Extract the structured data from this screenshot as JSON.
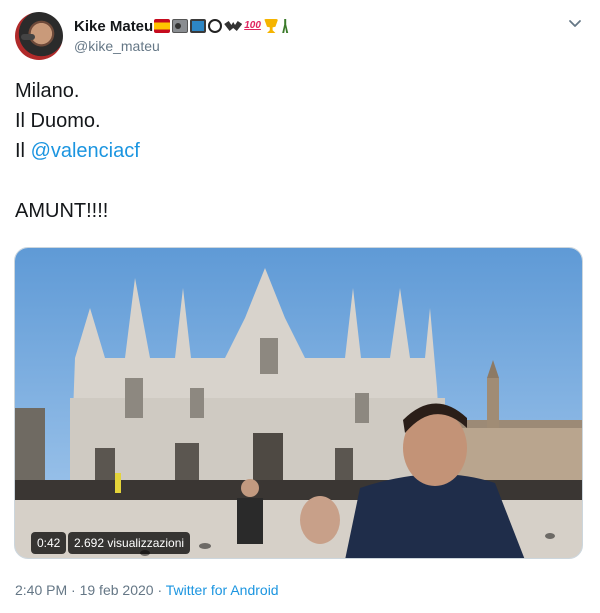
{
  "author": {
    "display_name": "Kike Mateu",
    "handle": "@kike_mateu",
    "emojis": [
      "spain-flag-icon",
      "radio-icon",
      "tv-icon",
      "soccer-ball-icon",
      "bat-icon",
      "hundred-points-icon",
      "trophy-icon",
      "golfer-icon"
    ]
  },
  "tweet": {
    "lines": [
      "Milano.",
      "Il Duomo.",
      "Il ",
      "",
      "AMUNT!!!!"
    ],
    "mention": "@valenciacf"
  },
  "media": {
    "duration": "0:42",
    "views": "2.692 visualizzazioni"
  },
  "meta": {
    "time": "2:40 PM",
    "separator": " · ",
    "date": "19 feb 2020",
    "source": "Twitter for Android"
  },
  "colors": {
    "accent": "#1b95e0",
    "text": "#14171a",
    "secondary": "#657786",
    "sky": "#7eaee0",
    "cathedral": "#d9d5d0"
  }
}
